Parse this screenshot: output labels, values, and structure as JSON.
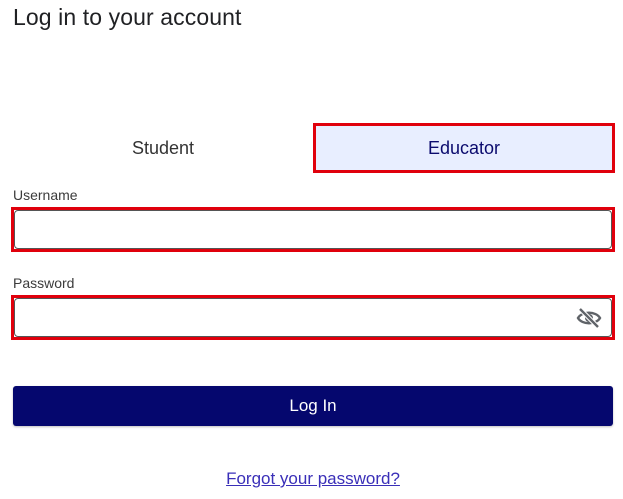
{
  "page": {
    "title": "Log in to your account"
  },
  "role_tabs": [
    {
      "label": "Student",
      "selected": false
    },
    {
      "label": "Educator",
      "selected": true
    }
  ],
  "username": {
    "label": "Username",
    "value": "",
    "placeholder": ""
  },
  "password": {
    "label": "Password",
    "value": "",
    "placeholder": "",
    "toggle_icon": "eye-slash-icon"
  },
  "actions": {
    "login_label": "Log In",
    "forgot_label": "Forgot your password?"
  },
  "colors": {
    "primary_button": "#05076e",
    "selected_tab_bg": "#e8eeff",
    "highlight_outline": "#e0000c",
    "link": "#3a2fb8"
  }
}
